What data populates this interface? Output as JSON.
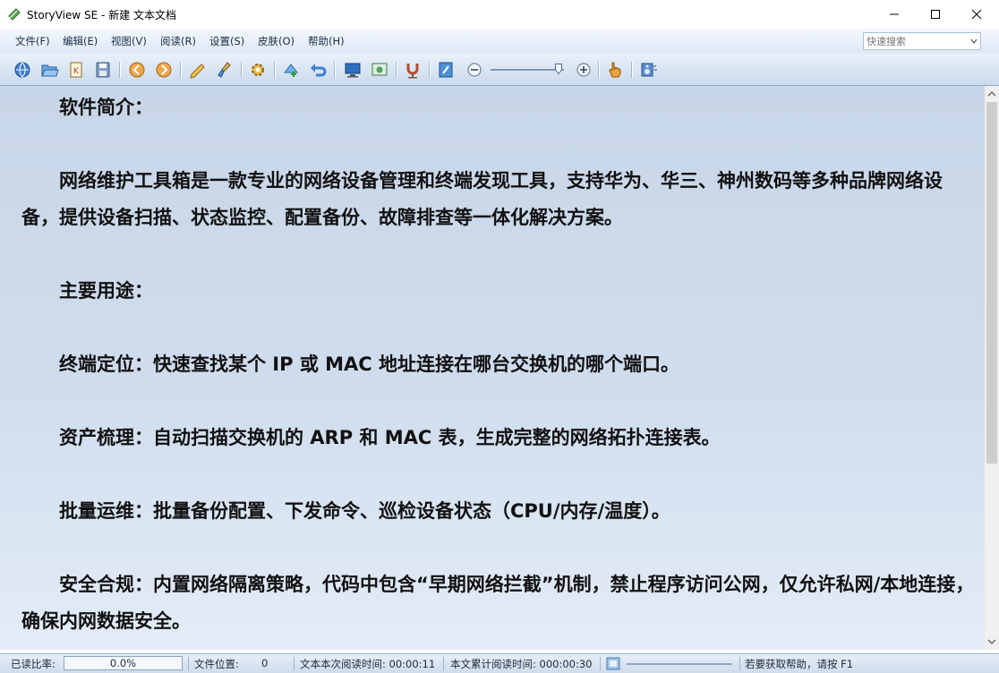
{
  "window": {
    "title": "StoryView SE - 新建 文本文档"
  },
  "menu": [
    {
      "label": "文件(F)"
    },
    {
      "label": "编辑(E)"
    },
    {
      "label": "视图(V)"
    },
    {
      "label": "阅读(R)"
    },
    {
      "label": "设置(S)"
    },
    {
      "label": "皮肤(O)"
    },
    {
      "label": "帮助(H)"
    }
  ],
  "search": {
    "placeholder": "快速搜索",
    "value": ""
  },
  "toolbar_icons": [
    "app-globe-icon",
    "open-folder-icon",
    "bookmark-k-icon",
    "save-disk-icon",
    "prev-page-icon",
    "next-page-icon",
    "pencil-note-icon",
    "clear-brush-icon",
    "settings-gear-icon",
    "add-bookmark-icon",
    "back-arrow-icon",
    "fullscreen-monitor-icon",
    "screenshot-icon",
    "tts-microphone-icon",
    "edit-notebook-icon",
    "zoom-out-icon",
    "zoom-in-icon",
    "hand-pointer-icon",
    "speaker-icon"
  ],
  "document": {
    "paragraphs": [
      "　　软件简介：",
      "",
      "　　网络维护工具箱是一款专业的网络设备管理和终端发现工具，支持华为、华三、神州数码等多种品牌网络设备，提供设备扫描、状态监控、配置备份、故障排查等一体化解决方案。",
      "",
      "　　主要用途：",
      "",
      "　　终端定位：快速查找某个 IP 或 MAC 地址连接在哪台交换机的哪个端口。",
      "",
      "　　资产梳理：自动扫描交换机的 ARP 和 MAC 表，生成完整的网络拓扑连接表。",
      "",
      "　　批量运维：批量备份配置、下发命令、巡检设备状态（CPU/内存/温度）。",
      "",
      "　　安全合规：内置网络隔离策略，代码中包含“早期网络拦截”机制，禁止程序访问公网，仅允许私网/本地连接，确保内网数据安全。"
    ]
  },
  "status": {
    "read_ratio_label": "已读比率:",
    "read_ratio_value": "0.0%",
    "file_pos_label": "文件位置:",
    "file_pos_value": "0",
    "session_time": "文本本次阅读时间: 00:00:11",
    "total_time": "本文累计阅读时间: 000:00:30",
    "help": "若要获取帮助，请按 F1"
  }
}
